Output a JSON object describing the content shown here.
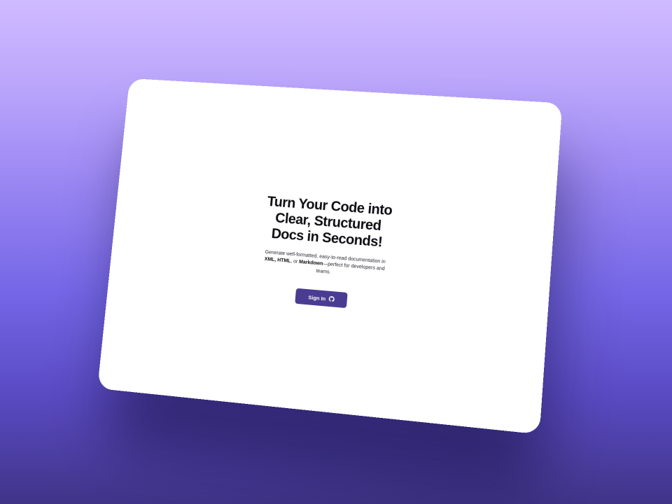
{
  "hero": {
    "title": "Turn Your Code into Clear, Structured Docs in Seconds!",
    "subtitle_parts": {
      "intro": "Generate well-formatted, easy-to-read documentation in ",
      "format_xml": "XML,",
      "format_html": "HTML",
      "sep": ", or ",
      "format_md": "Markdown",
      "outro": "—perfect for developers and teams."
    }
  },
  "auth": {
    "sign_in_label": "Sign In",
    "sign_in_icon": "github-icon"
  },
  "colors": {
    "button_bg": "#4a3c92",
    "background_top": "#cfbbff",
    "background_bottom": "#3f3488"
  }
}
